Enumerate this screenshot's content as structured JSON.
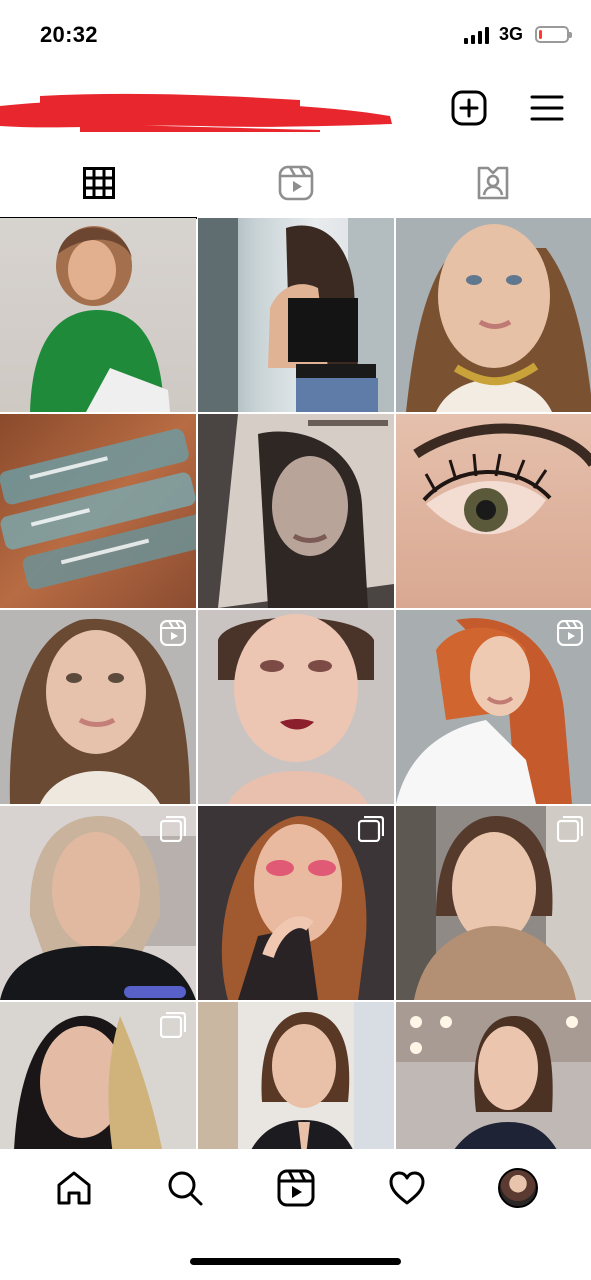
{
  "status_bar": {
    "time": "20:32",
    "network": "3G",
    "battery_level": 0.1,
    "battery_color": "#ff3b30",
    "signal_icon": "signal-bars-icon"
  },
  "header": {
    "redaction_color": "#e8262e",
    "create_icon": "plus-square-icon",
    "menu_icon": "hamburger-menu-icon"
  },
  "tabs": [
    {
      "icon": "grid-icon",
      "active": true
    },
    {
      "icon": "reels-icon",
      "active": false
    },
    {
      "icon": "tagged-person-icon",
      "active": false
    }
  ],
  "grid": {
    "tiles": [
      {
        "subject": "woman-green-sweater",
        "badge": null
      },
      {
        "subject": "woman-long-hair-window",
        "badge": null
      },
      {
        "subject": "woman-closeup-chain-necklace",
        "badge": null
      },
      {
        "subject": "lash-serum-tubes",
        "badge": null
      },
      {
        "subject": "certificate-portrait",
        "badge": null
      },
      {
        "subject": "eyelash-closeup",
        "badge": null
      },
      {
        "subject": "woman-wavy-hair",
        "badge": "reels-icon"
      },
      {
        "subject": "woman-red-lipstick",
        "badge": null
      },
      {
        "subject": "woman-red-hair",
        "badge": "reels-icon"
      },
      {
        "subject": "woman-black-top",
        "badge": "carousel-icon"
      },
      {
        "subject": "woman-pink-makeup",
        "badge": "carousel-icon"
      },
      {
        "subject": "woman-beige-sweater",
        "badge": "carousel-icon"
      },
      {
        "subject": "woman-with-dried-flowers",
        "badge": "carousel-icon"
      },
      {
        "subject": "woman-black-blazer",
        "badge": null
      },
      {
        "subject": "woman-ponytail-studio",
        "badge": null
      }
    ]
  },
  "bottom_nav": {
    "items": [
      {
        "icon": "home-icon"
      },
      {
        "icon": "search-icon"
      },
      {
        "icon": "reels-icon"
      },
      {
        "icon": "heart-icon"
      },
      {
        "icon": "profile-avatar"
      }
    ]
  }
}
